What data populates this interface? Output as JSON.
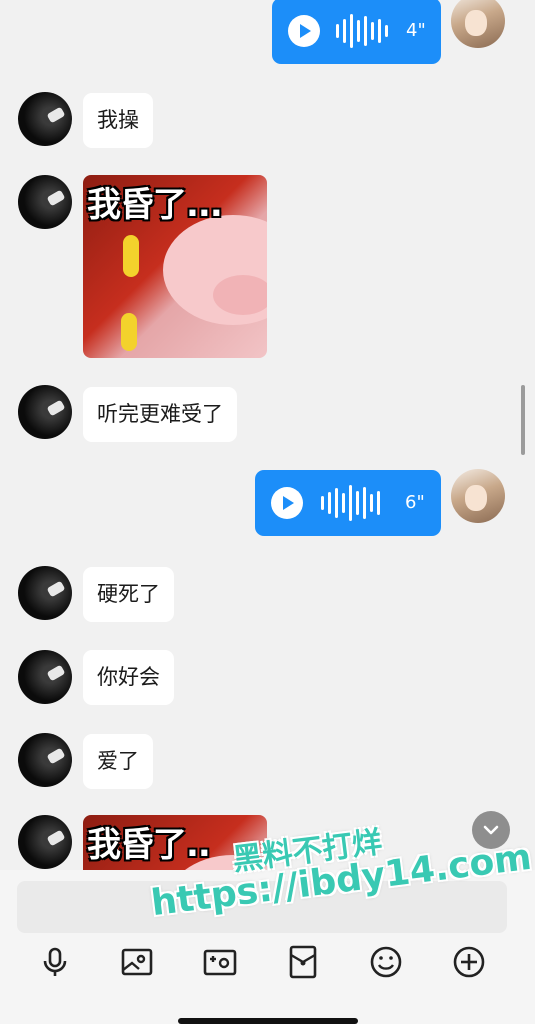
{
  "messages": [
    {
      "from": "self",
      "type": "voice",
      "duration": "4\""
    },
    {
      "from": "other",
      "type": "text",
      "text": "我操"
    },
    {
      "from": "other",
      "type": "sticker",
      "caption": "我昏了..."
    },
    {
      "from": "other",
      "type": "text",
      "text": "听完更难受了"
    },
    {
      "from": "self",
      "type": "voice",
      "duration": "6\""
    },
    {
      "from": "other",
      "type": "text",
      "text": "硬死了"
    },
    {
      "from": "other",
      "type": "text",
      "text": "你好会"
    },
    {
      "from": "other",
      "type": "text",
      "text": "爱了"
    },
    {
      "from": "other",
      "type": "sticker",
      "caption": "我昏了.."
    }
  ],
  "watermark": {
    "line1": "黑料不打烊",
    "line2": "https://ibdy14.com"
  },
  "toolbar": {
    "icons": [
      "microphone-icon",
      "image-icon",
      "camera-icon",
      "red-packet-icon",
      "emoji-icon",
      "plus-icon"
    ]
  },
  "colors": {
    "voice_bubble": "#1c8ef9",
    "background": "#f1f1f1",
    "watermark": "#39c9b3"
  }
}
